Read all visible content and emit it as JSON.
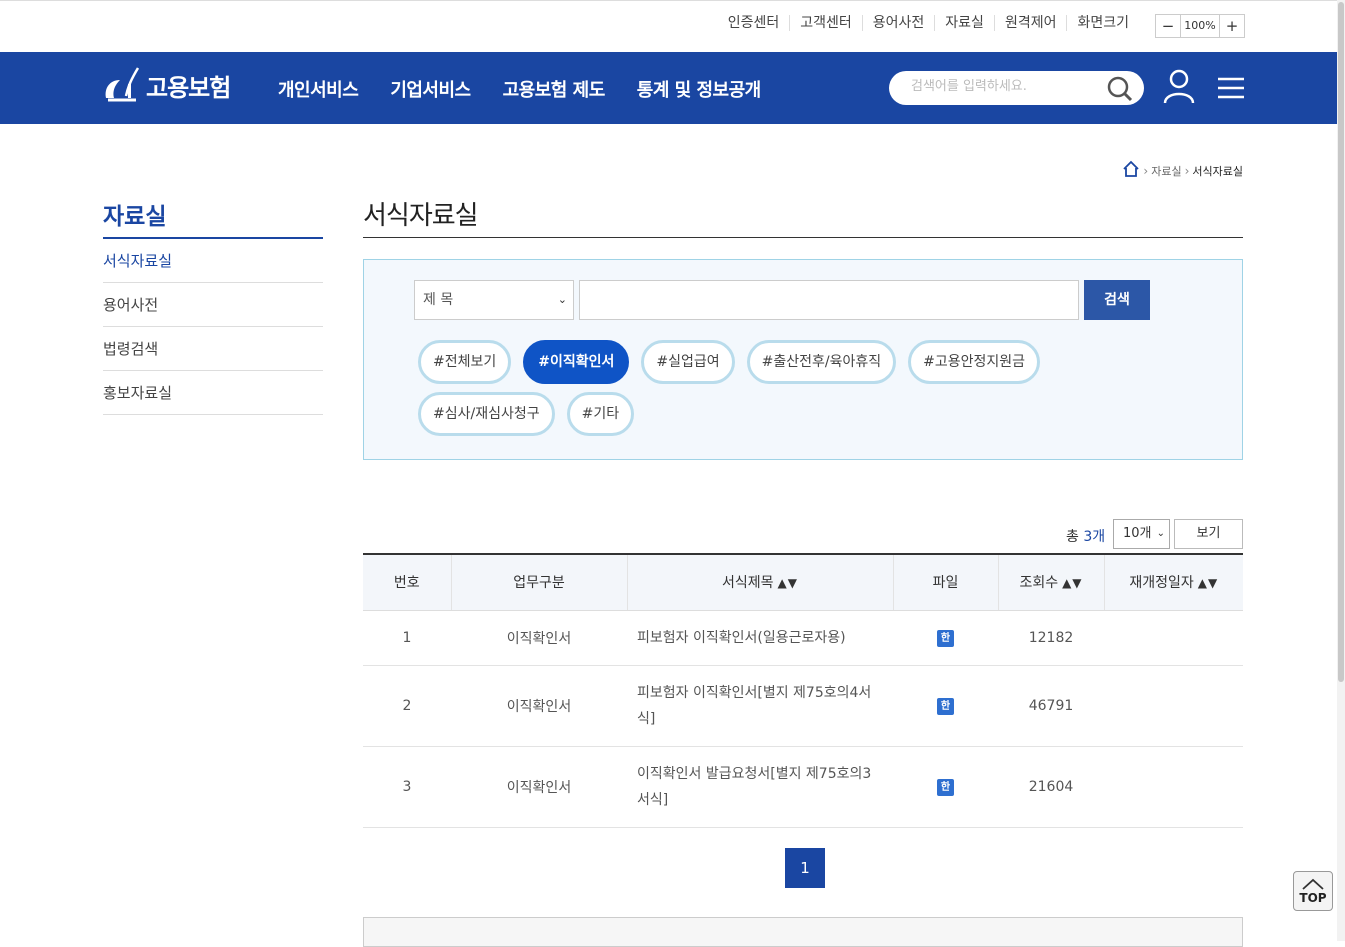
{
  "util": {
    "links": [
      "인증센터",
      "고객센터",
      "용어사전",
      "자료실",
      "원격제어"
    ],
    "zoom_label": "화면크기",
    "zoom_minus": "−",
    "zoom_value": "100%",
    "zoom_plus": "+"
  },
  "header": {
    "logo_text": "고용보험",
    "menu": [
      "개인서비스",
      "기업서비스",
      "고용보험 제도",
      "통계 및 정보공개"
    ],
    "search_placeholder": "검색어를 입력하세요."
  },
  "breadcrumb": {
    "items": [
      "자료실",
      "서식자료실"
    ]
  },
  "lnb": {
    "title": "자료실",
    "items": [
      "서식자료실",
      "용어사전",
      "법령검색",
      "홍보자료실"
    ]
  },
  "main": {
    "title": "서식자료실",
    "search": {
      "select_value": "제 목",
      "button": "검색"
    },
    "tags": [
      "#전체보기",
      "#이직확인서",
      "#실업급여",
      "#출산전후/육아휴직",
      "#고용안정지원금",
      "#심사/재심사청구",
      "#기타"
    ],
    "active_tag_index": 1,
    "total_prefix": "총",
    "total_count": "3개",
    "per_page": "10개",
    "view_button": "보기",
    "table": {
      "headers": [
        "번호",
        "업무구분",
        "서식제목",
        "파일",
        "조회수",
        "재개정일자"
      ],
      "sort_arrows": "▲▼",
      "rows": [
        {
          "no": "1",
          "category": "이직확인서",
          "title": "피보험자 이직확인서(일용근로자용)",
          "file": "hwp",
          "views": "12182",
          "date": ""
        },
        {
          "no": "2",
          "category": "이직확인서",
          "title": "피보험자 이직확인서[별지 제75호의4서식]",
          "file": "hwp",
          "views": "46791",
          "date": ""
        },
        {
          "no": "3",
          "category": "이직확인서",
          "title": "이직확인서 발급요청서[별지 제75호의3서식]",
          "file": "hwp",
          "views": "21604",
          "date": ""
        }
      ]
    },
    "pagination": {
      "current": "1"
    }
  },
  "top_button": "TOP",
  "colors": {
    "brand": "#1a46a2",
    "active_tag": "#0f54c6",
    "tag_border": "#b9dcec"
  }
}
